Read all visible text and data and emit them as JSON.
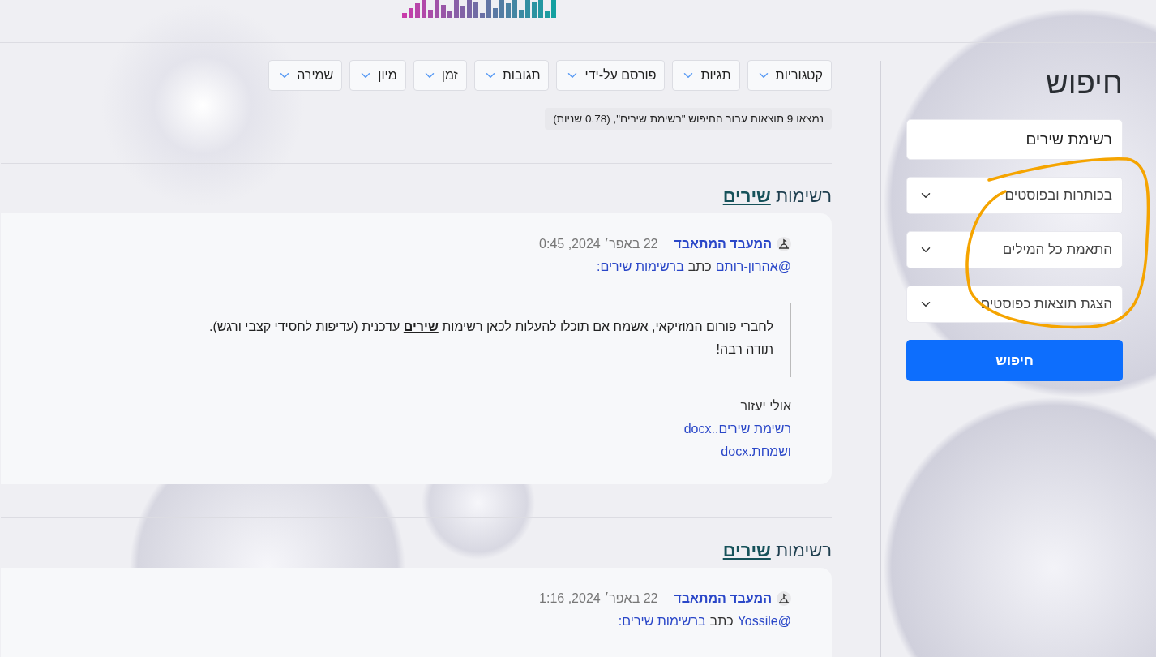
{
  "sidebar": {
    "title": "חיפוש",
    "query": "רשימת שירים",
    "selects": [
      "בכותרות ובפוסטים",
      "התאמת כל המילים",
      "הצגת תוצאות כפוסטים"
    ],
    "submit": "חיפוש"
  },
  "annotation": {
    "kind": "circle"
  },
  "filters": [
    "קטגוריות",
    "תגיות",
    "פורסם על-ידי",
    "תגובות",
    "זמן",
    "מיון",
    "שמירה"
  ],
  "summary": "נמצאו 9 תוצאות עבור החיפוש \"רשימת שירים\", (0.78 שניות)",
  "results": [
    {
      "title": "רשימות **שירים**",
      "author": "המעבד המתאבד",
      "date": "22 באפר׳ 2024, 0:45",
      "mention": "@אהרון-רותם",
      "verb": "כתב",
      "topic": "ברשימות שירים:",
      "quote": [
        "לחברי פורום המוזיקאי, אשמח אם תוכלו להעלות לכאן רשימות **שירים** עדכנית (עדיפות לחסידי קצבי ורגש).",
        "תודה רבה!"
      ],
      "body": "אולי יעזור",
      "attachments": [
        "רשימת שירים..docx",
        "ושמחת.docx"
      ]
    },
    {
      "title": "רשימות **שירים**",
      "author": "המעבד המתאבד",
      "date": "22 באפר׳ 2024, 1:16",
      "mention": "@Yossile",
      "verb": "כתב",
      "topic": "ברשימות שירים:"
    }
  ]
}
